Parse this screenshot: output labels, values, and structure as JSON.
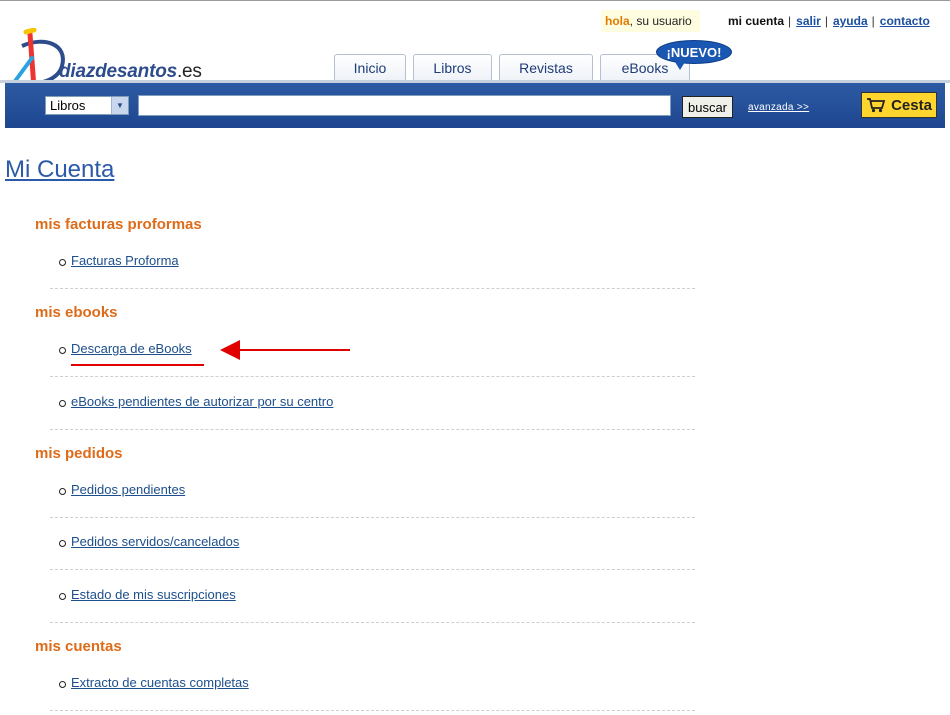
{
  "brand": {
    "logo_main": "diazdesantos",
    "logo_tld": ".es",
    "accent": "#2d4c8c"
  },
  "header": {
    "greeting": "hola",
    "user": ", su usuario",
    "current": "mi cuenta",
    "links": [
      "salir",
      "ayuda",
      "contacto"
    ],
    "separator": "|"
  },
  "tabs": [
    "Inicio",
    "Libros",
    "Revistas",
    "eBooks"
  ],
  "new_badge": "¡NUEVO!",
  "search": {
    "category": "Libros",
    "value": "",
    "button": "buscar",
    "advanced": "avanzada >>",
    "cart": "Cesta"
  },
  "page_title": "Mi Cuenta",
  "sections": [
    {
      "title": "mis facturas proformas",
      "items": [
        "Facturas Proforma"
      ]
    },
    {
      "title": "mis ebooks",
      "items": [
        "Descarga de eBooks",
        "eBooks pendientes de autorizar por su centro"
      ]
    },
    {
      "title": "mis pedidos",
      "items": [
        "Pedidos pendientes",
        "Pedidos servidos/cancelados",
        "Estado de mis suscripciones"
      ]
    },
    {
      "title": "mis cuentas",
      "items": [
        "Extracto de cuentas completas"
      ]
    }
  ],
  "colors": {
    "section_heading": "#de6b1a",
    "link": "#1d4f8c",
    "search_bar": "#1e4690",
    "annotation": "#e00000"
  }
}
